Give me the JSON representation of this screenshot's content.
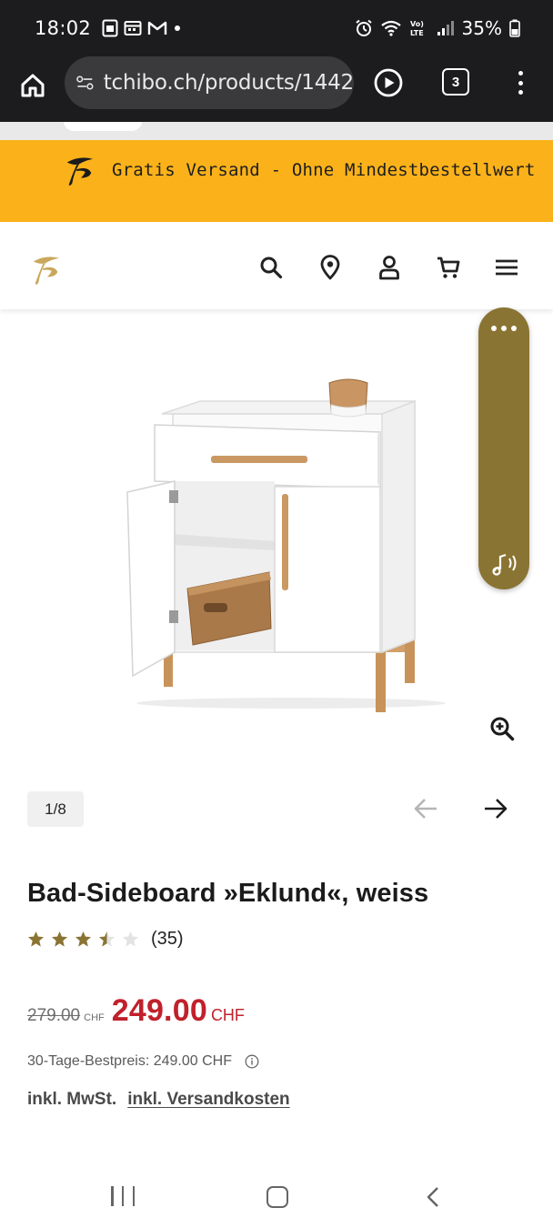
{
  "status_bar": {
    "time": "18:02",
    "battery": "35%",
    "notification_icons": [
      "sim-card-icon",
      "calendar-icon",
      "gmail-icon",
      "dot-icon"
    ],
    "system_icons": [
      "alarm-icon",
      "wifi-icon",
      "volte-icon",
      "signal-icon",
      "battery-icon"
    ]
  },
  "browser": {
    "url": "tchibo.ch/products/1442",
    "tab_count": "3"
  },
  "promo": {
    "text": "Gratis Versand - Ohne Mindestbestellwert",
    "background": "#fbb21a"
  },
  "header": {
    "icons": [
      "search-icon",
      "location-icon",
      "account-icon",
      "cart-icon",
      "menu-icon"
    ]
  },
  "gallery": {
    "counter": "1/8"
  },
  "product": {
    "title": "Bad-Sideboard »Eklund«, weiss",
    "rating": 3.5,
    "rating_max": 5,
    "review_count": "(35)",
    "old_price": "279.00",
    "old_currency": "CHF",
    "new_price": "249.00",
    "new_currency": "CHF",
    "best_price": "30-Tage-Bestpreis: 249.00 CHF",
    "tax_label": "inkl. MwSt.",
    "shipping_label": "inkl. Versandkosten"
  },
  "colors": {
    "accent_gold": "#8a7433",
    "sale_red": "#c0212b",
    "promo_yellow": "#fbb21a"
  }
}
